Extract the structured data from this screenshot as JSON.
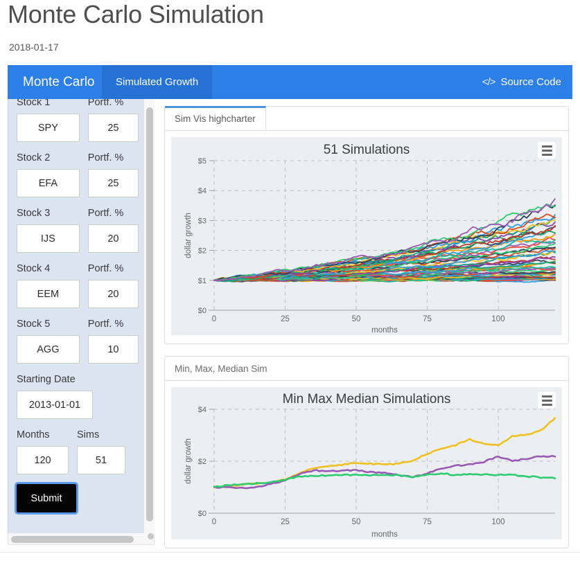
{
  "header": {
    "title": "Monte Carlo Simulation",
    "date": "2018-01-17"
  },
  "navbar": {
    "brand": "Monte Carlo",
    "active_tab": "Simulated Growth",
    "source_code_label": "Source Code",
    "code_icon": "</>",
    "bg_color": "#2D7FE8",
    "active_tab_color": "#2672D4"
  },
  "sidebar": {
    "bg_color": "#DCE3F1",
    "fields": [
      {
        "label": "Stock 1",
        "value": "SPY",
        "pct_label": "Portf. %",
        "pct_value": "25"
      },
      {
        "label": "Stock 2",
        "value": "EFA",
        "pct_label": "Portf. %",
        "pct_value": "25"
      },
      {
        "label": "Stock 3",
        "value": "IJS",
        "pct_label": "Portf. %",
        "pct_value": "20"
      },
      {
        "label": "Stock 4",
        "value": "EEM",
        "pct_label": "Portf. %",
        "pct_value": "20"
      },
      {
        "label": "Stock 5",
        "value": "AGG",
        "pct_label": "Portf. %",
        "pct_value": "10"
      }
    ],
    "starting_date_label": "Starting Date",
    "starting_date_value": "2013-01-01",
    "months_label": "Months",
    "months_value": "120",
    "sims_label": "Sims",
    "sims_value": "51",
    "submit_label": "Submit"
  },
  "panel1": {
    "tab_label": "Sim Vis highcharter"
  },
  "panel2": {
    "header_label": "Min, Max, Median Sim"
  },
  "chart_data": [
    {
      "type": "line",
      "title": "51 Simulations",
      "xlabel": "months",
      "ylabel": "dollar growth",
      "xticks": [
        0,
        25,
        50,
        75,
        100
      ],
      "yticks": [
        "$0",
        "$1",
        "$2",
        "$3",
        "$4",
        "$5"
      ],
      "xlim": [
        0,
        120
      ],
      "ylim": [
        0,
        5
      ],
      "grid": true,
      "legend": "none",
      "n_series": 51,
      "palette": [
        "#F0C020",
        "#2F9BE0",
        "#D94A1E",
        "#2E4057",
        "#2ECC71",
        "#9B59B6",
        "#E74C3C",
        "#1ABC9C",
        "#F39C12",
        "#3498DB",
        "#34495E",
        "#27AE60",
        "#C0392B",
        "#8E44AD",
        "#16A085"
      ],
      "series_note": "51 simulated portfolio growth paths, all starting at $1 at month 0, fanning out to roughly $1.1-$3.7 by month 120",
      "start_value": 1.0,
      "end_range": [
        1.0,
        3.7
      ]
    },
    {
      "type": "line",
      "title": "Min Max Median Simulations",
      "xlabel": "months",
      "ylabel": "dollar growth",
      "xticks": [
        0,
        25,
        50,
        75,
        100
      ],
      "yticks": [
        "$0",
        "$2",
        "$4"
      ],
      "xlim": [
        0,
        120
      ],
      "ylim": [
        0,
        4
      ],
      "grid": true,
      "legend": "none",
      "series": [
        {
          "name": "max",
          "color": "#F0C020",
          "x": [
            0,
            5,
            10,
            15,
            20,
            25,
            30,
            35,
            40,
            45,
            50,
            55,
            60,
            65,
            70,
            75,
            80,
            85,
            90,
            95,
            100,
            105,
            110,
            115,
            120
          ],
          "values": [
            1.0,
            1.02,
            1.1,
            1.13,
            1.2,
            1.31,
            1.53,
            1.74,
            1.82,
            1.86,
            1.95,
            1.9,
            1.88,
            1.9,
            2.02,
            2.29,
            2.48,
            2.62,
            2.85,
            2.66,
            2.6,
            2.97,
            3.02,
            3.19,
            3.66
          ]
        },
        {
          "name": "median",
          "color": "#9B59B6",
          "x": [
            0,
            5,
            10,
            15,
            20,
            25,
            30,
            35,
            40,
            45,
            50,
            55,
            60,
            65,
            70,
            75,
            80,
            85,
            90,
            95,
            100,
            105,
            110,
            115,
            120
          ],
          "values": [
            1.0,
            1.0,
            0.96,
            1.0,
            1.12,
            1.25,
            1.5,
            1.65,
            1.62,
            1.64,
            1.66,
            1.58,
            1.55,
            1.48,
            1.4,
            1.52,
            1.73,
            1.82,
            1.87,
            1.98,
            2.18,
            2.0,
            2.1,
            2.2,
            2.18
          ]
        },
        {
          "name": "min",
          "color": "#2ECC71",
          "x": [
            0,
            5,
            10,
            15,
            20,
            25,
            30,
            35,
            40,
            45,
            50,
            55,
            60,
            65,
            70,
            75,
            80,
            85,
            90,
            95,
            100,
            105,
            110,
            115,
            120
          ],
          "values": [
            1.0,
            1.08,
            1.12,
            1.15,
            1.2,
            1.28,
            1.42,
            1.45,
            1.44,
            1.48,
            1.47,
            1.46,
            1.47,
            1.46,
            1.38,
            1.47,
            1.54,
            1.46,
            1.5,
            1.48,
            1.48,
            1.47,
            1.42,
            1.38,
            1.34
          ]
        }
      ]
    }
  ]
}
